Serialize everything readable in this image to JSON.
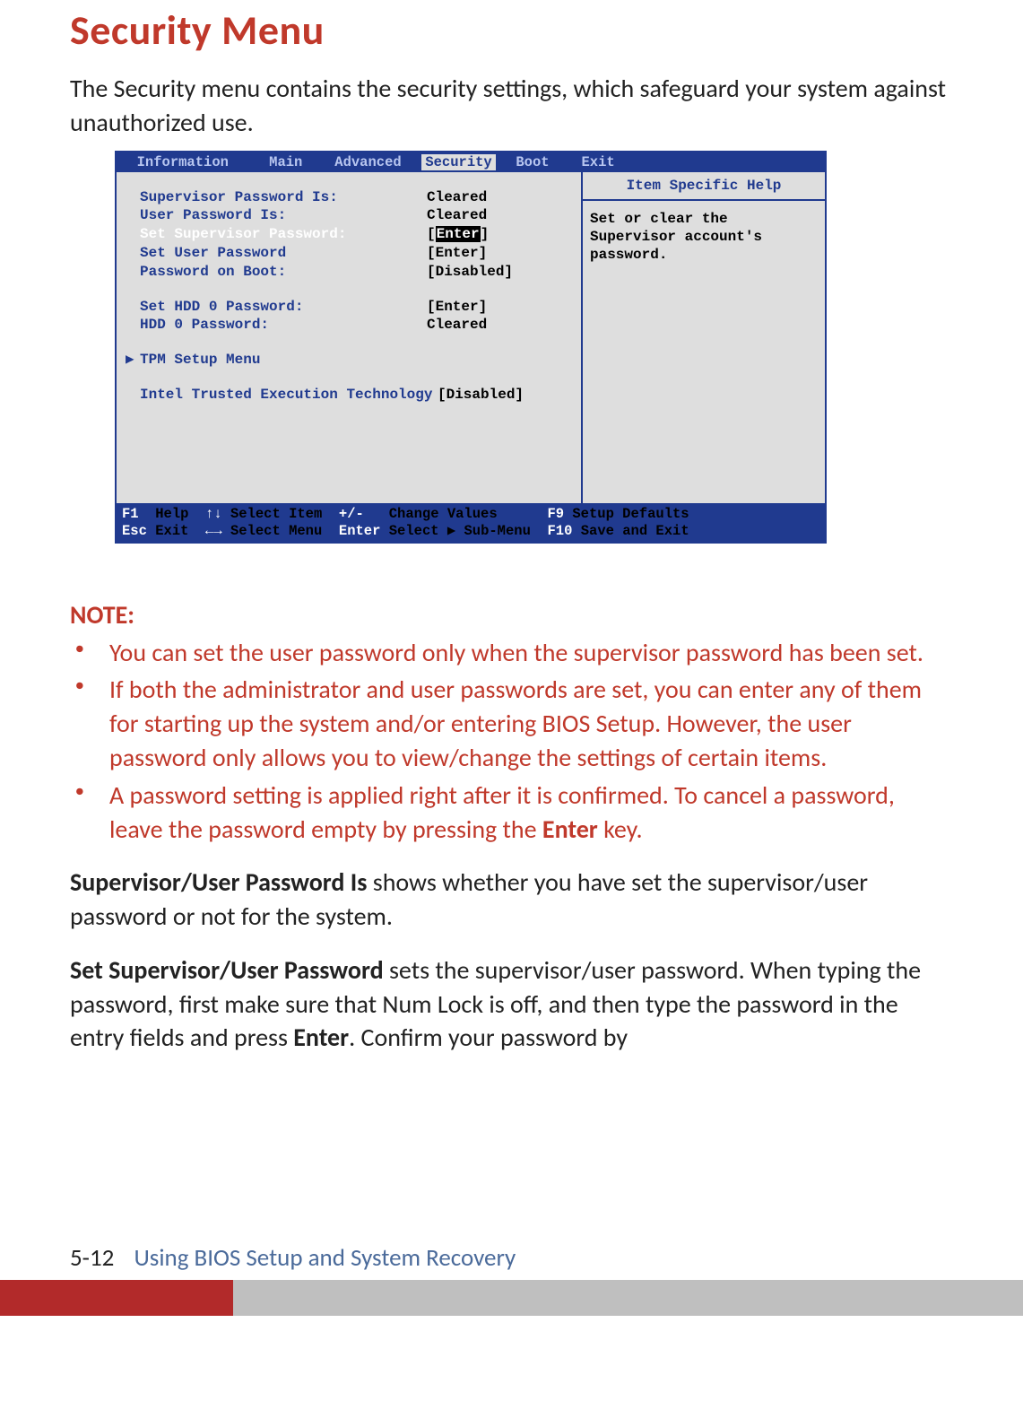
{
  "title": "Security Menu",
  "intro": "The Security menu contains the security settings, which safeguard your system against unauthorized use.",
  "bios": {
    "tabs": {
      "padLeft": "  ",
      "t0": "Information",
      "t1": "Main",
      "t2": "Advanced",
      "t3": "Security",
      "t4": "Boot",
      "t5": "Exit",
      "gap01": "    ",
      "gap12": "   ",
      "gap23": "  ",
      "gap34": "  ",
      "gap45": "   "
    },
    "rows": {
      "r0_label": "Supervisor Password Is:",
      "r0_val": "Cleared",
      "r1_label": "User Password Is:",
      "r1_val": "Cleared",
      "r2_label": "Set Supervisor Password:",
      "r2_b1": "[",
      "r2_val": "Enter",
      "r2_b2": "]",
      "r3_label": "Set User Password",
      "r3_val": "[Enter]",
      "r4_label": "Password on Boot:",
      "r4_val": "[Disabled]",
      "r5_label": "Set HDD 0 Password:",
      "r5_val": "[Enter]",
      "r6_label": "HDD 0 Password:",
      "r6_val": "Cleared",
      "r7_arrow": "▶",
      "r7_label": "TPM Setup Menu",
      "r8_label": "Intel Trusted Execution Technology",
      "r8_val": "[Disabled]"
    },
    "help": {
      "header": "Item Specific Help",
      "text": "Set or clear the Supervisor account's password."
    },
    "footer": {
      "f1k": "F1",
      "f1d": "Help",
      "f2k": "↑↓",
      "f2d": "Select Item",
      "f3k": "+/-",
      "f3d": "Change Values",
      "f4k": "F9",
      "f4d": "Setup Defaults",
      "g1k": "Esc",
      "g1d": "Exit",
      "g2k": "←→",
      "g2d": "Select Menu",
      "g3k": "Enter",
      "g3d": "Select ▶ Sub-Menu",
      "g4k": "F10",
      "g4d": "Save and Exit"
    }
  },
  "note_heading": "NOTE:",
  "notes": {
    "n0": "You can set the user password only when the supervisor password has been set.",
    "n1": "If both the administrator and user passwords are set, you can enter any of them for starting up the system and/or entering BIOS Setup. However, the user password only allows you to view/change the settings of certain items.",
    "n2_a": "A password setting is applied right after it is confirmed. To cancel a password, leave the password empty by pressing the ",
    "n2_key": "Enter",
    "n2_b": " key."
  },
  "para1": {
    "term": "Supervisor/User Password Is",
    "rest": "  shows whether you have set the supervisor/user password or not for the system."
  },
  "para2": {
    "term": "Set Supervisor/User Password",
    "rest_a": "  sets the supervisor/user password. When typing the password, first make sure that Num Lock is off, and then type the password in the entry fields and press ",
    "enter": "Enter",
    "rest_b": ". Confirm your password by"
  },
  "footer": {
    "page_num": "5-12",
    "section": "Using BIOS Setup and System Recovery"
  }
}
